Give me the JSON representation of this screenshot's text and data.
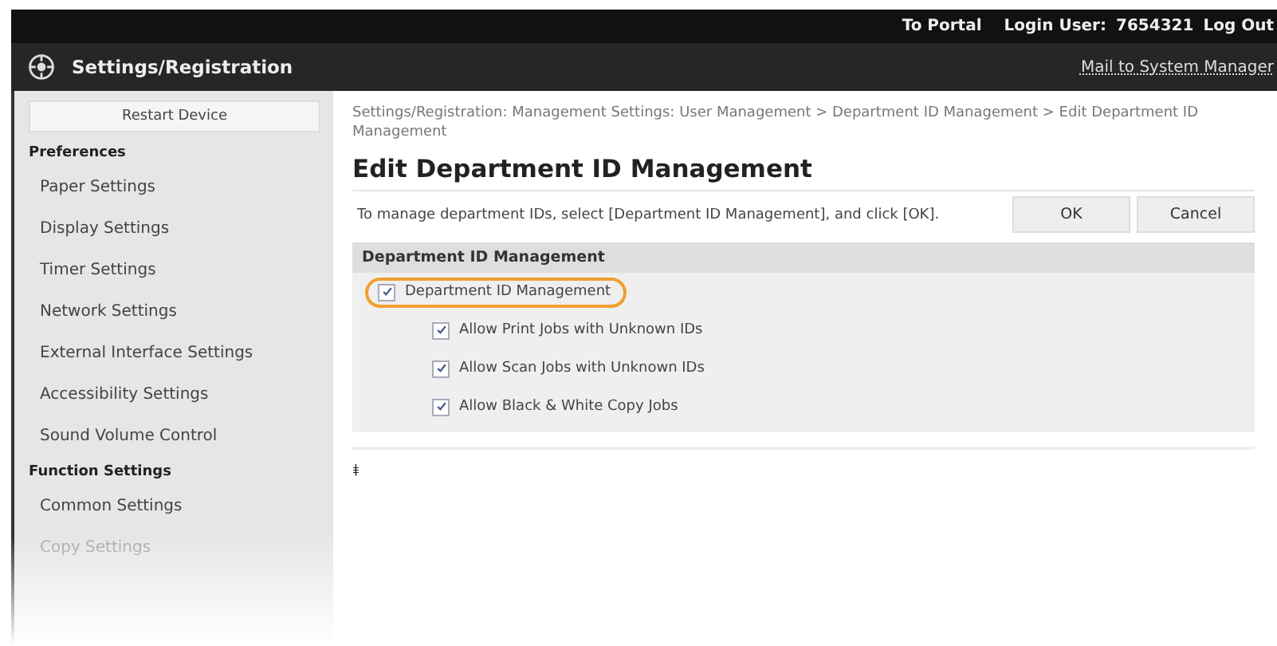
{
  "top_bar": {
    "links": [
      {
        "kind": "link",
        "text": "To Portal"
      },
      {
        "kind": "label",
        "text": "Login User:"
      },
      {
        "kind": "label",
        "text": "7654321"
      },
      {
        "kind": "link",
        "text": "Log Out"
      }
    ]
  },
  "header": {
    "title": "Settings/Registration",
    "mail_link": "Mail to System Manager"
  },
  "sidebar": {
    "restart_button": "Restart Device",
    "sections": [
      {
        "heading": "Preferences",
        "items": [
          {
            "label": "Paper Settings",
            "faded": false
          },
          {
            "label": "Display Settings",
            "faded": false
          },
          {
            "label": "Timer Settings",
            "faded": false
          },
          {
            "label": "Network Settings",
            "faded": false
          },
          {
            "label": "External Interface Settings",
            "faded": false
          },
          {
            "label": "Accessibility Settings",
            "faded": false
          },
          {
            "label": "Sound Volume Control",
            "faded": false
          }
        ]
      },
      {
        "heading": "Function Settings",
        "items": [
          {
            "label": "Common Settings",
            "faded": false
          },
          {
            "label": "Copy Settings",
            "faded": true
          }
        ]
      }
    ]
  },
  "breadcrumb": "Settings/Registration: Management Settings: User Management > Department ID Management > Edit Department ID Management",
  "page_title": "Edit Department ID Management",
  "instruction": "To manage department IDs, select [Department ID Management], and click [OK].",
  "buttons": [
    "OK",
    "Cancel"
  ],
  "section": {
    "heading": "Department ID Management",
    "options": [
      {
        "label": "Department ID Management",
        "checked": true,
        "highlighted": true,
        "children": [
          {
            "label": "Allow Print Jobs with Unknown IDs",
            "checked": true,
            "highlighted": false
          },
          {
            "label": "Allow Scan Jobs with Unknown IDs",
            "checked": true,
            "highlighted": false
          },
          {
            "label": "Allow Black & White Copy Jobs",
            "checked": true,
            "highlighted": false
          }
        ]
      }
    ]
  },
  "back_to_top": "⯒"
}
